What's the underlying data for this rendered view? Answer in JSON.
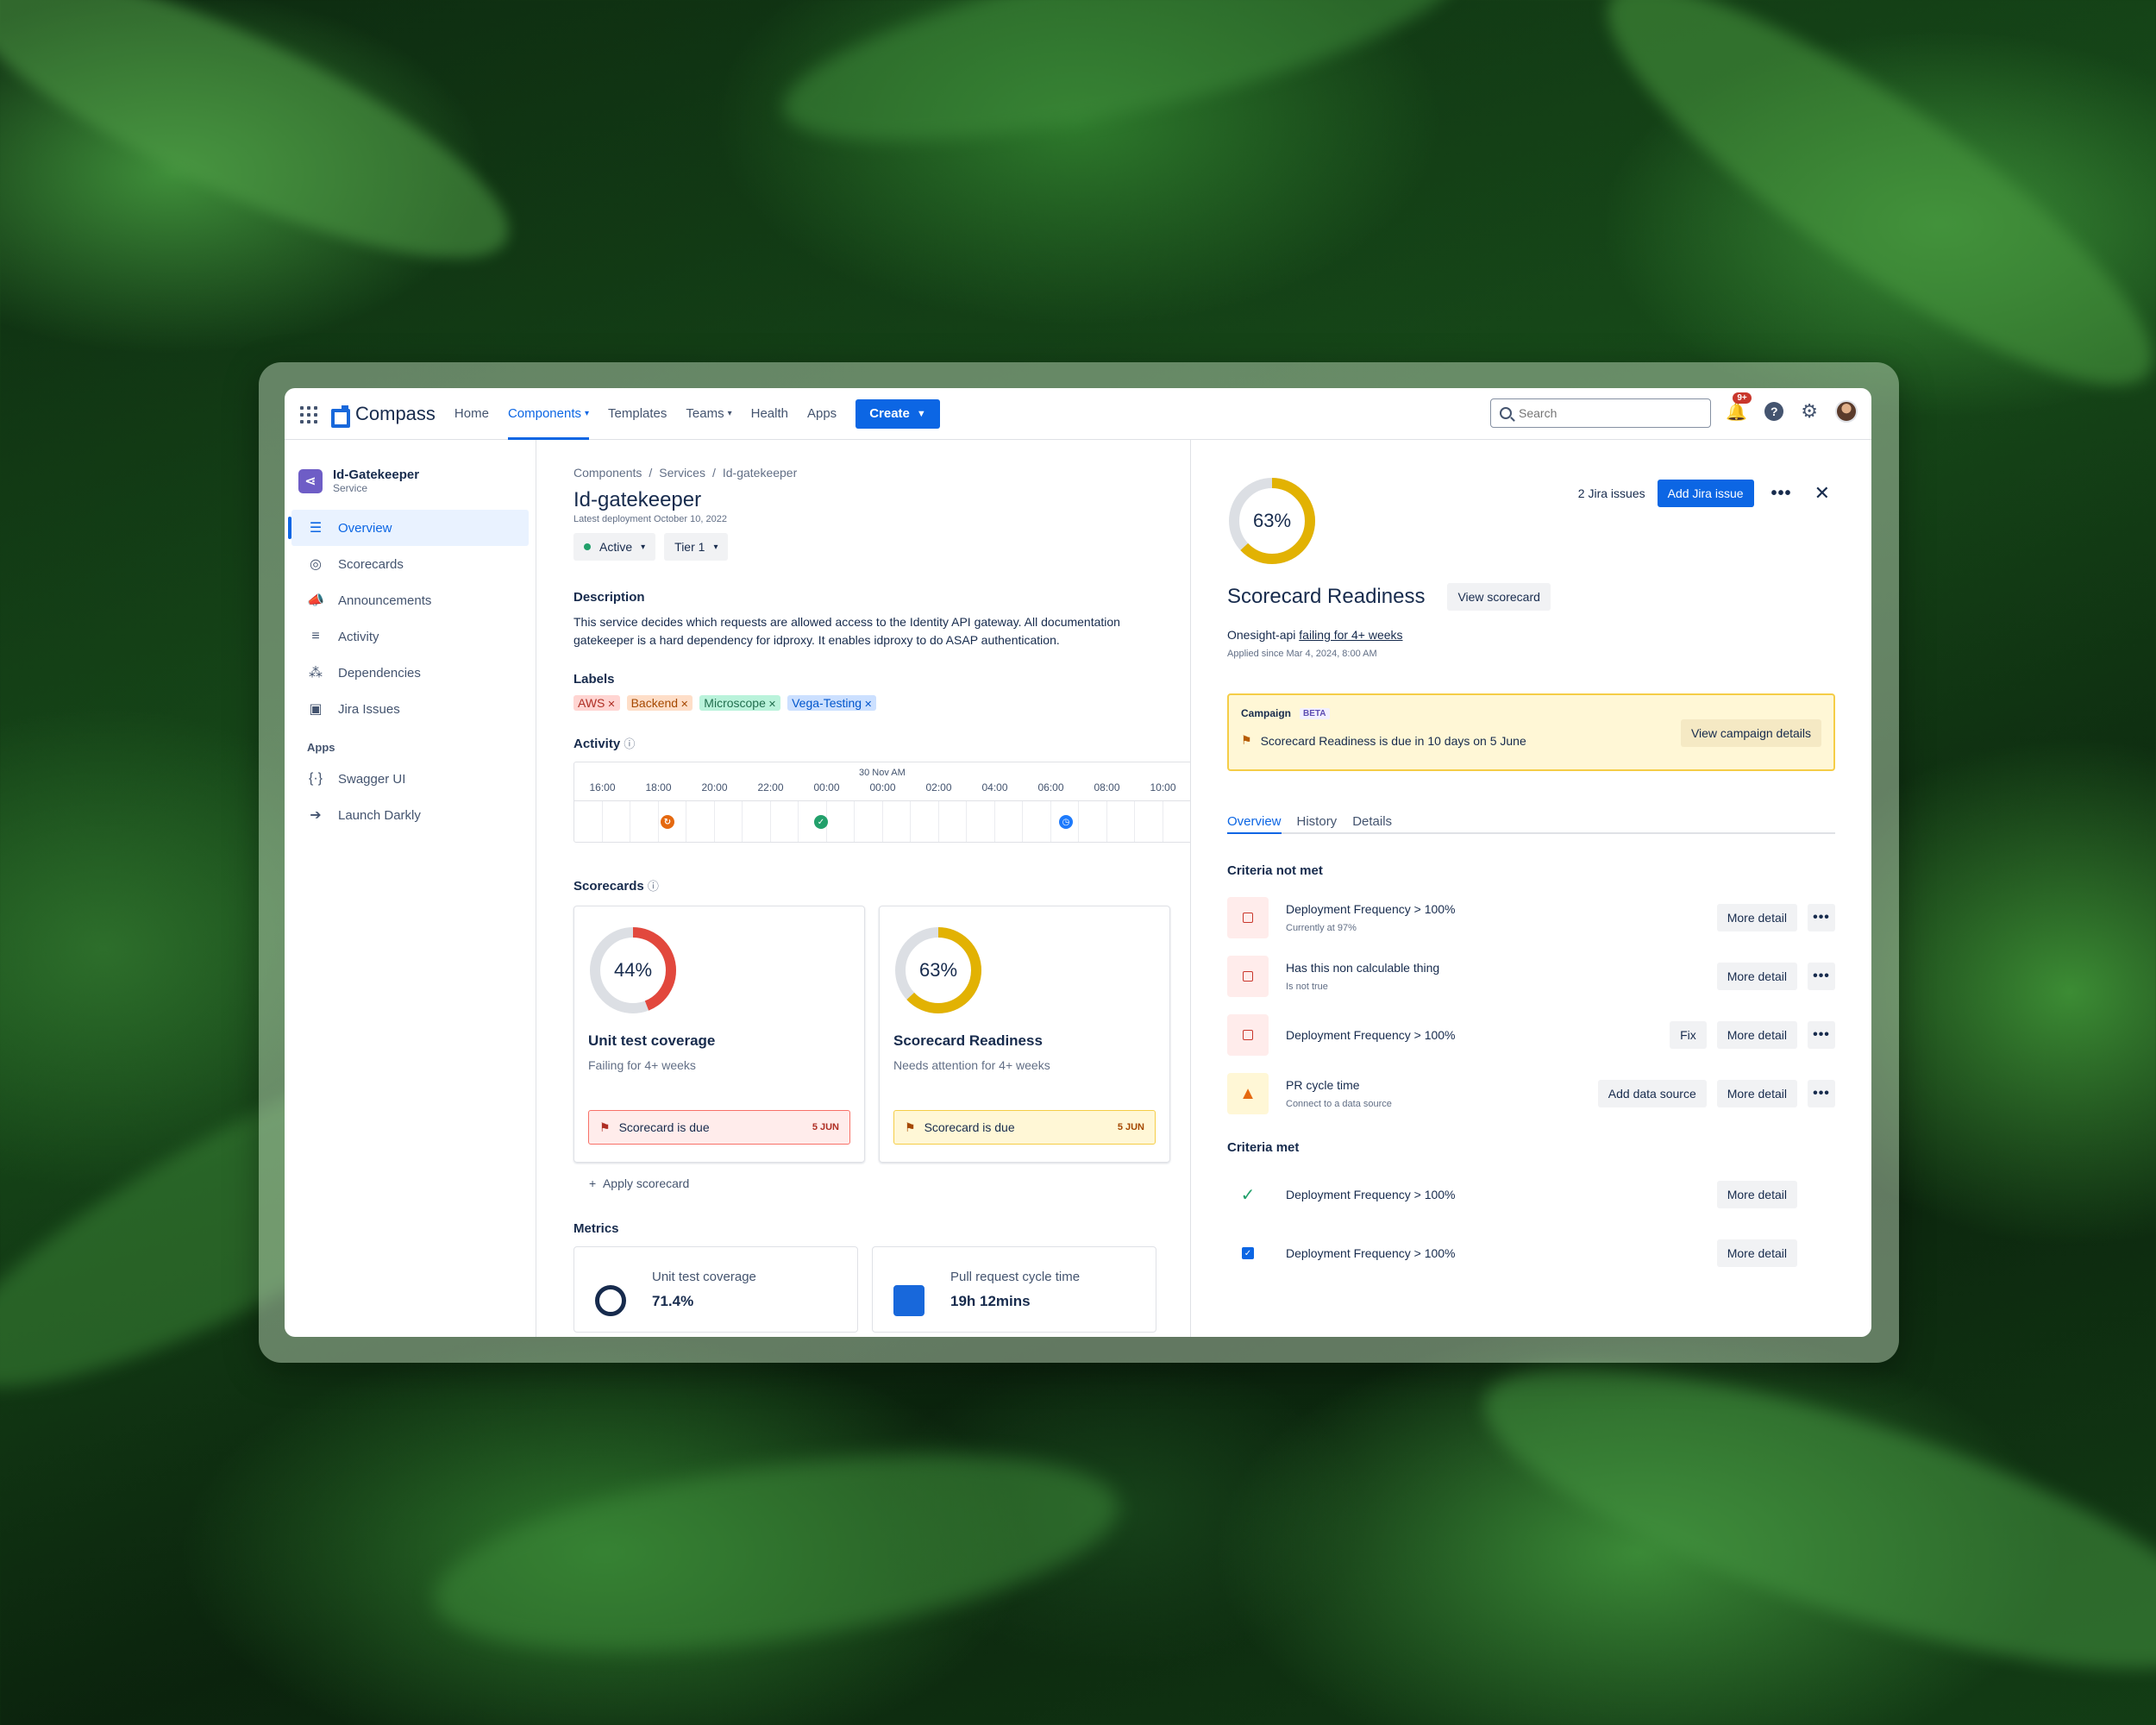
{
  "topnav": {
    "logo": "Compass",
    "items": [
      {
        "label": "Home"
      },
      {
        "label": "Components",
        "active": true,
        "dropdown": true
      },
      {
        "label": "Templates"
      },
      {
        "label": "Teams",
        "dropdown": true
      },
      {
        "label": "Health"
      },
      {
        "label": "Apps"
      }
    ],
    "create_label": "Create",
    "search_placeholder": "Search",
    "notification_badge": "9+"
  },
  "sidebar": {
    "service_name": "Id-Gatekeeper",
    "service_type": "Service",
    "items": [
      {
        "label": "Overview",
        "icon": "overview-icon",
        "active": true
      },
      {
        "label": "Scorecards",
        "icon": "scorecards-icon"
      },
      {
        "label": "Announcements",
        "icon": "megaphone-icon"
      },
      {
        "label": "Activity",
        "icon": "activity-icon"
      },
      {
        "label": "Dependencies",
        "icon": "dependencies-icon"
      },
      {
        "label": "Jira Issues",
        "icon": "jira-icon"
      }
    ],
    "apps_heading": "Apps",
    "apps": [
      {
        "label": "Swagger UI",
        "icon": "swagger-icon"
      },
      {
        "label": "Launch Darkly",
        "icon": "launchdarkly-icon"
      }
    ]
  },
  "main": {
    "breadcrumb": [
      "Components",
      "Services",
      "Id-gatekeeper"
    ],
    "title": "Id-gatekeeper",
    "subtitle": "Latest deployment October 10, 2022",
    "status": "Active",
    "tier": "Tier 1",
    "description_heading": "Description",
    "description_line1": "This service decides which requests are allowed access to the Identity API gateway. All documentation",
    "description_line2": "gatekeeper is a hard dependency for idproxy. It enables idproxy to do ASAP authentication.",
    "labels_heading": "Labels",
    "labels": [
      {
        "text": "AWS",
        "bg": "#ffd5d2",
        "fg": "#ae2e24"
      },
      {
        "text": "Backend",
        "bg": "#fedec8",
        "fg": "#a54800"
      },
      {
        "text": "Microscope",
        "bg": "#baf3db",
        "fg": "#216e4e"
      },
      {
        "text": "Vega-Testing",
        "bg": "#cce0ff",
        "fg": "#0055cc"
      }
    ],
    "activity_heading": "Activity",
    "activity_date": "30 Nov AM",
    "activity_ticks": [
      "16:00",
      "18:00",
      "20:00",
      "22:00",
      "00:00",
      "00:00",
      "02:00",
      "04:00",
      "06:00",
      "08:00",
      "10:00"
    ],
    "scorecards_heading": "Scorecards",
    "scorecards": [
      {
        "percent": 44,
        "percent_label": "44%",
        "title": "Unit test coverage",
        "status": "Failing for 4+ weeks",
        "due_label": "Scorecard is due",
        "due_date": "5 JUN",
        "color": "#e2483d",
        "due_bg": "#ffeceb",
        "due_border": "#f87168",
        "due_fg": "#ae2e24"
      },
      {
        "percent": 63,
        "percent_label": "63%",
        "title": "Scorecard Readiness",
        "status": "Needs attention for 4+ weeks",
        "due_label": "Scorecard is due",
        "due_date": "5 JUN",
        "color": "#e2b203",
        "due_bg": "#fff7d6",
        "due_border": "#f5cd47",
        "due_fg": "#a54800"
      }
    ],
    "apply_label": "Apply scorecard",
    "metrics_heading": "Metrics",
    "metrics": [
      {
        "label": "Unit test coverage",
        "value": "71.4%",
        "icon": "github-icon"
      },
      {
        "label": "Pull request cycle time",
        "value": "19h 12mins",
        "icon": "bitbucket-icon"
      }
    ]
  },
  "panel": {
    "percent": 63,
    "percent_label": "63%",
    "jira_count": "2 Jira issues",
    "add_jira_label": "Add Jira issue",
    "title": "Scorecard Readiness",
    "view_scorecard_label": "View scorecard",
    "component_name": "Onesight-api",
    "failing_text": "failing for 4+ weeks",
    "applied_since": "Applied since Mar 4, 2024, 8:00 AM",
    "campaign": {
      "heading": "Campaign",
      "badge": "BETA",
      "text": "Scorecard Readiness is due in 10 days on 5 June",
      "button": "View campaign details"
    },
    "tabs": [
      {
        "label": "Overview",
        "active": true
      },
      {
        "label": "History"
      },
      {
        "label": "Details"
      }
    ],
    "criteria_not_met_heading": "Criteria not met",
    "criteria_not_met": [
      {
        "title": "Deployment Frequency > 100%",
        "sub": "Currently at 97%",
        "kind": "fail",
        "buttons": [
          "More detail"
        ]
      },
      {
        "title": "Has this non calculable thing",
        "sub": "Is not true",
        "kind": "fail",
        "buttons": [
          "More detail"
        ]
      },
      {
        "title": "Deployment Frequency > 100%",
        "sub": "",
        "kind": "fail",
        "buttons": [
          "Fix",
          "More detail"
        ]
      },
      {
        "title": "PR cycle time",
        "sub": "Connect to a data source",
        "kind": "warn",
        "buttons": [
          "Add data source",
          "More detail"
        ]
      }
    ],
    "criteria_met_heading": "Criteria met",
    "criteria_met": [
      {
        "title": "Deployment Frequency > 100%",
        "kind": "ok",
        "button": "More detail"
      },
      {
        "title": "Deployment Frequency > 100%",
        "kind": "chk",
        "button": "More detail"
      }
    ]
  }
}
